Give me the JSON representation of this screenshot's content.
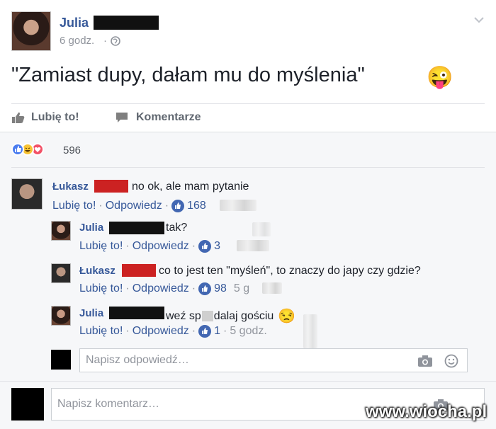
{
  "post": {
    "author": "Julia",
    "time": "6 godz.",
    "separator": "·",
    "text": "\"Zamiast dupy, dałam mu do myślenia\"",
    "emoji": "😜"
  },
  "actions": {
    "like": "Lubię to!",
    "comment": "Komentarze"
  },
  "reactions": {
    "count": "596",
    "types": [
      "like-icon",
      "haha-icon",
      "love-icon"
    ]
  },
  "comments": [
    {
      "author": "Łukasz",
      "text": "no ok, ale mam pytanie",
      "like": "Lubię to!",
      "dot1": "·",
      "reply": "Odpowiedz",
      "dot2": "·",
      "likes": "168"
    }
  ],
  "replies": [
    {
      "author": "Julia",
      "text": "tak?",
      "like": "Lubię to!",
      "dot": "·",
      "reply": "Odpowiedz",
      "dot2": "·",
      "likes": "3",
      "time": ""
    },
    {
      "author": "Łukasz",
      "text": "co to jest ten \"myśleń\", to znaczy do japy czy gdzie?",
      "like": "Lubię to!",
      "dot": "·",
      "reply": "Odpowiedz",
      "dot2": "·",
      "likes": "98",
      "time": "5 g"
    },
    {
      "author": "Julia",
      "text_a": "weź sp",
      "text_b": "dalaj gościu",
      "emoji": "😒",
      "like": "Lubię to!",
      "dot": "·",
      "reply": "Odpowiedz",
      "dot2": "·",
      "likes": "1",
      "dot3": "·",
      "time": "5 godz."
    }
  ],
  "reply_input": {
    "placeholder": "Napisz odpowiedź…"
  },
  "comment_input": {
    "placeholder": "Napisz komentarz…"
  },
  "watermark": "www.wiocha.pl",
  "colors": {
    "link": "#365899",
    "like_blue": "#4267b2",
    "redaction_red": "#cc2222"
  }
}
